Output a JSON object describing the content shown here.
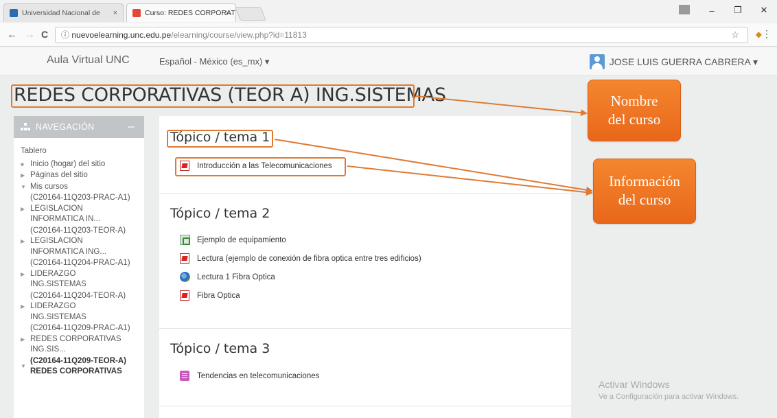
{
  "browser": {
    "tabs": [
      {
        "title": "Universidad Nacional de",
        "close": "×",
        "favicon_color": "#2b6cb0"
      },
      {
        "title": "Curso: REDES CORPORAT",
        "close": "×",
        "favicon_color": "#e4473a"
      }
    ],
    "window_buttons": {
      "profile": "1",
      "minimize": "–",
      "maximize": "❐",
      "close": "✕"
    },
    "nav": {
      "back": "←",
      "forward": "→",
      "reload": "C",
      "info": "ⓘ"
    },
    "url_host": "nuevoelearning.unc.edu.pe",
    "url_path": "/elearning/course/view.php?id=11813",
    "star": "☆",
    "menu": "⋮"
  },
  "header": {
    "brand": "Aula Virtual UNC",
    "language": "Español - México (es_mx) ▾",
    "user_name": "JOSE LUIS GUERRA CABRERA ▾"
  },
  "course": {
    "title": "REDES CORPORATIVAS (TEOR A) ING.SISTEMAS"
  },
  "navigation": {
    "heading": "NAVEGACIÓN",
    "items": {
      "dashboard": "Tablero",
      "home": "Inicio (hogar) del sitio",
      "site_pages": "Páginas del sitio",
      "my_courses": "Mis cursos"
    },
    "courses": [
      {
        "label": "(C20164-11Q203-PRAC-A1) LEGISLACION INFORMATICA IN...",
        "marker": "▶"
      },
      {
        "label": "(C20164-11Q203-TEOR-A) LEGISLACION INFORMATICA ING...",
        "marker": "▶"
      },
      {
        "label": "(C20164-11Q204-PRAC-A1) LIDERAZGO ING.SISTEMAS",
        "marker": "▶"
      },
      {
        "label": "(C20164-11Q204-TEOR-A) LIDERAZGO ING.SISTEMAS",
        "marker": "▶"
      },
      {
        "label": "(C20164-11Q209-PRAC-A1) REDES CORPORATIVAS ING.SIS...",
        "marker": "▶"
      },
      {
        "label": "(C20164-11Q209-TEOR-A) REDES CORPORATIVAS",
        "marker": "▼"
      }
    ]
  },
  "sections": [
    {
      "title": "Tópico / tema 1",
      "activities": [
        {
          "name": "Introducción a las Telecomunicaciones",
          "icon": "pdf-icon"
        }
      ]
    },
    {
      "title": "Tópico / tema 2",
      "activities": [
        {
          "name": "Ejemplo de equipamiento",
          "icon": "spreadsheet-icon"
        },
        {
          "name": "Lectura (ejemplo de conexión de fibra optica entre tres edificios)",
          "icon": "pdf-icon"
        },
        {
          "name": "Lectura 1 Fibra Optica",
          "icon": "url-globe-icon"
        },
        {
          "name": "Fibra Optica",
          "icon": "pdf-icon"
        }
      ]
    },
    {
      "title": "Tópico / tema 3",
      "activities": [
        {
          "name": "Tendencias en telecomunicaciones",
          "icon": "page-icon"
        }
      ]
    }
  ],
  "callouts": {
    "course_name": {
      "line1": "Nombre",
      "line2": "del curso"
    },
    "course_info": {
      "line1": "Información",
      "line2": "del curso"
    }
  },
  "watermark": {
    "title": "Activar Windows",
    "subtitle": "Ve a Configuración para activar Windows."
  },
  "colors": {
    "callout": "#ee7425",
    "highlight_border": "#e07a33",
    "nav_header": "#c1c5c7"
  }
}
